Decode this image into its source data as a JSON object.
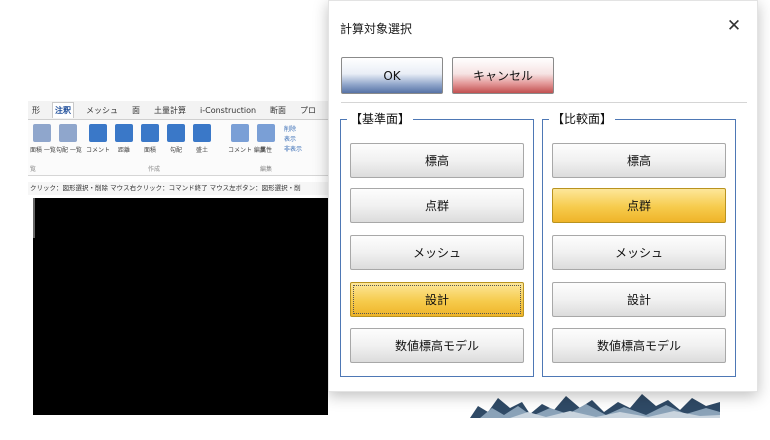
{
  "background_app": {
    "ribbon_tabs": [
      {
        "label": "形",
        "active": false
      },
      {
        "label": "注釈",
        "active": true
      },
      {
        "label": "メッシュ",
        "active": false
      },
      {
        "label": "面",
        "active": false
      },
      {
        "label": "土量計算",
        "active": false
      },
      {
        "label": "i-Construction",
        "active": false
      },
      {
        "label": "断面",
        "active": false
      },
      {
        "label": "プロ",
        "active": false
      }
    ],
    "ribbon_items": [
      {
        "label": "面積 一覧",
        "icon": "area-list-icon",
        "color": "#6a86b8"
      },
      {
        "label": "勾配 一覧",
        "icon": "slope-list-icon",
        "color": "#6a86b8"
      },
      {
        "label": "コメント",
        "icon": "comment-icon",
        "color": "#3a78c8"
      },
      {
        "label": "距離",
        "icon": "distance-icon",
        "color": "#3a78c8"
      },
      {
        "label": "面積",
        "icon": "area-icon",
        "color": "#3a78c8"
      },
      {
        "label": "勾配",
        "icon": "slope-icon",
        "color": "#3a78c8"
      },
      {
        "label": "盛土",
        "icon": "fill-icon",
        "color": "#3a78c8"
      },
      {
        "label": "コメント 編集",
        "icon": "comment-edit-icon",
        "color": "#7a9fd6"
      },
      {
        "label": "属性",
        "icon": "attribute-icon",
        "color": "#7a9fd6"
      }
    ],
    "ribbon_small": [
      "削除",
      "表示",
      "非表示"
    ],
    "ribbon_groups": [
      "覧",
      "作成",
      "編集"
    ],
    "status_text": "クリック：図形選択・削除 マウス右クリック：コマンド終了 マウス左ボタン：図形選択・削"
  },
  "dialog": {
    "title": "計算対象選択",
    "close_glyph": "✕",
    "ok_label": "OK",
    "cancel_label": "キャンセル",
    "reference": {
      "title": "【基準面】",
      "options": [
        "標高",
        "点群",
        "メッシュ",
        "設計",
        "数値標高モデル"
      ],
      "selected_index": 3
    },
    "comparison": {
      "title": "【比較面】",
      "options": [
        "標高",
        "点群",
        "メッシュ",
        "設計",
        "数値標高モデル"
      ],
      "selected_index": 1
    }
  }
}
